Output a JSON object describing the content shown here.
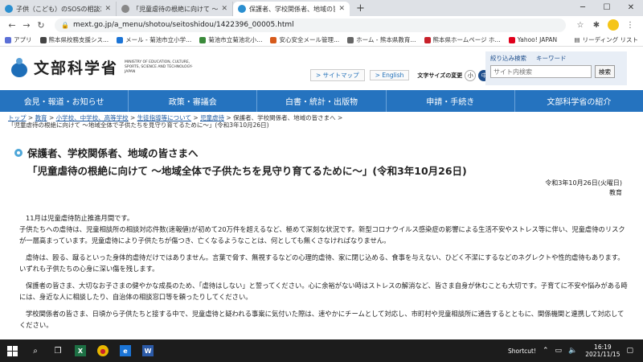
{
  "browser": {
    "tabs": [
      {
        "title": "子供（こども）のSOSの相談窓口",
        "color": "#2b8fd0"
      },
      {
        "title": "「児童虐待の根絶に向けて 〜地域全",
        "color": "#888888"
      },
      {
        "title": "保護者、学校関係者、地域の皆さまへ",
        "color": "#2b8fd0"
      }
    ],
    "new_tab": "+",
    "url": "mext.go.jp/a_menu/shotou/seitoshidou/1422396_00005.html",
    "bookmarks": [
      {
        "label": "アプリ",
        "color": "#5b6fd6"
      },
      {
        "label": "熊本県校務支援シス...",
        "color": "#444444"
      },
      {
        "label": "メール - 菊池市立小学...",
        "color": "#1b74d6"
      },
      {
        "label": "菊池市立菊池北小...",
        "color": "#3a8a3a"
      },
      {
        "label": "安心安全メール管理...",
        "color": "#d65a1b"
      },
      {
        "label": "ホーム - 熊本県教育...",
        "color": "#666666"
      },
      {
        "label": "熊本県ホームページ ホ...",
        "color": "#c8202a"
      },
      {
        "label": "Yahoo! JAPAN",
        "color": "#e0001b"
      }
    ],
    "reading_list": "リーディング リスト"
  },
  "site": {
    "logo_text": "文部科学省",
    "logo_en": "MINISTRY OF EDUCATION, CULTURE, SPORTS, SCIENCE AND TECHNOLOGY-JAPAN",
    "sitemap": "> サイトマップ",
    "english": "> English",
    "font_size_label": "文字サイズの変更",
    "font_sizes": [
      "小",
      "中",
      "大"
    ],
    "search_tabs": [
      "絞り込み検索",
      "キーワード"
    ],
    "search_placeholder": "サイト内検索",
    "search_button": "検索",
    "nav": [
      "会見・報道・お知らせ",
      "政策・審議会",
      "白書・統計・出版物",
      "申請・手続き",
      "文部科学省の紹介"
    ]
  },
  "breadcrumb": {
    "items": [
      "トップ",
      "教育",
      "小学校、中学校、高等学校",
      "生徒指導等について",
      "児童虐待"
    ],
    "current": "保護者、学校関係者、地域の皆さまへ",
    "line2": "「児童虐待の根絶に向けて 〜地域全体で子供たちを見守り育てるために〜」(令和3年10月26日)"
  },
  "article": {
    "heading1": "保護者、学校関係者、地域の皆さまへ",
    "heading2": "「児童虐待の根絶に向けて 〜地域全体で子供たちを見守り育てるために〜」(令和3年10月26日)",
    "date": "令和3年10月26日(火曜日)",
    "category": "教育",
    "paragraphs": [
      "11月は児童虐待防止推進月間です。\n子供たちへの虐待は、児童相談所の相談対応件数(速報値)が初めて20万件を超えるなど、極めて深刻な状況です。新型コロナウイルス感染症の影響による生活不安やストレス等に伴い、児童虐待のリスクが一層高まっています。児童虐待により子供たちが傷つき、亡くなるようなことは、何としても無くさなければなりません。",
      "虐待は、殴る、蹴るといった身体的虐待だけではありません。言葉で脅す、無視するなどの心理的虐待、家に閉じ込める、食事を与えない、ひどく不潔にするなどのネグレクトや性的虐待もあります。いずれも子供たちの心身に深い傷を残します。",
      "保護者の皆さま、大切なお子さまの健やかな成長のため、「虐待はしない」と誓ってください。心に余裕がない時はストレスの解消など、皆さま自身が休むことも大切です。子育てに不安や悩みがある時には、身近な人に相談したり、自治体の相談窓口等を頼ったりしてください。",
      "学校関係者の皆さま、日頃から子供たちと接する中で、児童虐待と疑われる事案に気付いた際は、速やかにチームとして対応し、市町村や児童相談所に通告するとともに、関係機関と連携して対応してください。"
    ]
  },
  "taskbar": {
    "shortcut": "Shortcut!",
    "time": "16:19",
    "date": "2021/11/15",
    "apps": [
      "X",
      "●",
      "e",
      "W"
    ]
  }
}
